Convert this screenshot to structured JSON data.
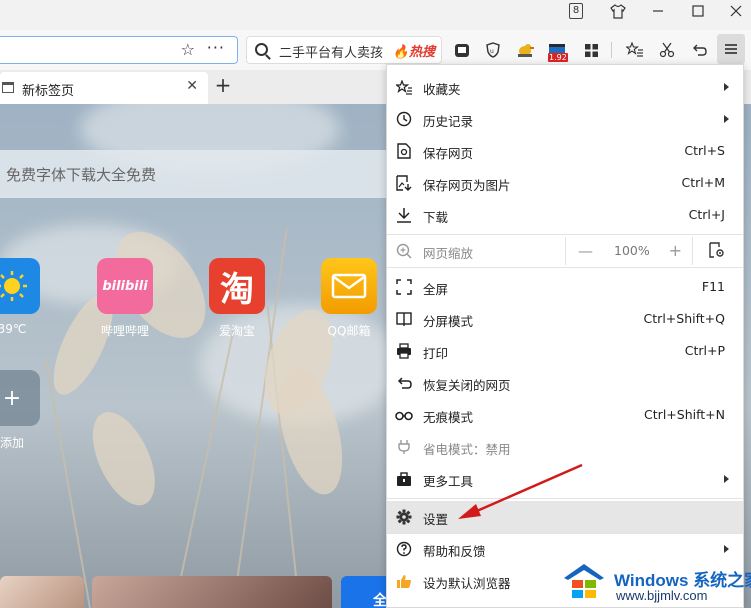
{
  "window": {
    "tab_count": "8"
  },
  "toolbar": {
    "search_text": "二手平台有人卖孩",
    "search_hot": "热搜",
    "ext_badge": "1.92"
  },
  "tabs": [
    {
      "title": "新标签页"
    }
  ],
  "page": {
    "search_placeholder": "免费字体下载大全免费",
    "tiles": [
      {
        "label": "39℃"
      },
      {
        "label": "哔哩哔哩",
        "icon_text": "bilibili"
      },
      {
        "label": "爱淘宝",
        "icon_text": "淘"
      },
      {
        "label": "QQ邮箱"
      }
    ],
    "add_label": "添加",
    "bottom_text": "全"
  },
  "menu": {
    "items": [
      {
        "label": "收藏夹",
        "icon": "star-list-icon",
        "submenu": true
      },
      {
        "label": "历史记录",
        "icon": "history-icon",
        "submenu": true
      },
      {
        "label": "保存网页",
        "icon": "save-page-icon",
        "shortcut": "Ctrl+S"
      },
      {
        "label": "保存网页为图片",
        "icon": "save-image-icon",
        "shortcut": "Ctrl+M"
      },
      {
        "label": "下载",
        "icon": "download-icon",
        "shortcut": "Ctrl+J"
      },
      {
        "label": "网页缩放",
        "icon": "zoom-icon",
        "zoom_value": "100%",
        "minus": "—",
        "plus": "+"
      },
      {
        "label": "全屏",
        "icon": "fullscreen-icon",
        "shortcut": "F11"
      },
      {
        "label": "分屏模式",
        "icon": "split-screen-icon",
        "shortcut": "Ctrl+Shift+Q"
      },
      {
        "label": "打印",
        "icon": "print-icon",
        "shortcut": "Ctrl+P"
      },
      {
        "label": "恢复关闭的网页",
        "icon": "restore-icon"
      },
      {
        "label": "无痕模式",
        "icon": "incognito-icon",
        "shortcut": "Ctrl+Shift+N"
      },
      {
        "label": "省电模式：禁用",
        "icon": "power-plug-icon"
      },
      {
        "label": "更多工具",
        "icon": "toolbox-icon",
        "submenu": true
      },
      {
        "label": "设置",
        "icon": "gear-icon"
      },
      {
        "label": "帮助和反馈",
        "icon": "help-icon",
        "submenu": true
      },
      {
        "label": "设为默认浏览器",
        "icon": "thumbs-up-icon"
      }
    ]
  },
  "watermark": {
    "brand": "Windows",
    "brand_cn": "系统之家",
    "url": "www.bjjmlv.com"
  },
  "colors": {
    "accent": "#7fb3f0",
    "arrow": "#d11a1a",
    "hot": "#e53a2f"
  }
}
